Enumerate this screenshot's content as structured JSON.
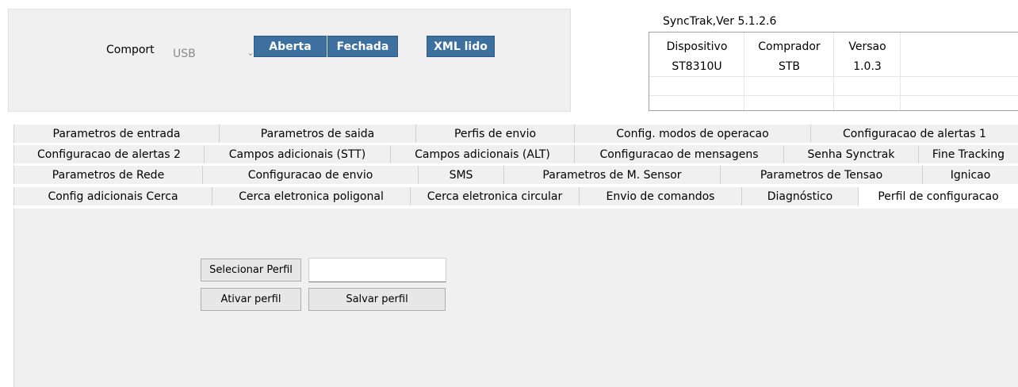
{
  "comport": {
    "label": "Comport",
    "selected": "USB",
    "buttons": {
      "open": "Aberta",
      "close": "Fechada",
      "xml": "XML lido"
    }
  },
  "version": {
    "title": "SyncTrak,Ver 5.1.2.6",
    "columns": [
      "Dispositivo",
      "Comprador",
      "Versao"
    ],
    "row": [
      "ST8310U",
      "STB",
      "1.0.3"
    ]
  },
  "tabs": {
    "row1": [
      "Parametros de entrada",
      "Parametros de saida",
      "Perfis de envio",
      "Config. modos de operacao",
      "Configuracao de alertas 1"
    ],
    "row2": [
      "Configuracao de alertas 2",
      "Campos adicionais (STT)",
      "Campos adicionais (ALT)",
      "Configuracao de mensagens",
      "Senha Synctrak",
      "Fine Tracking"
    ],
    "row3": [
      "Parametros de Rede",
      "Configuracao de envio",
      "SMS",
      "Parametros de M. Sensor",
      "Parametros de Tensao",
      "Ignicao"
    ],
    "row4": [
      "Config adicionais Cerca",
      "Cerca eletronica poligonal",
      "Cerca eletronica circular",
      "Envio de comandos",
      "Diagnóstico",
      "Perfil de configuracao"
    ],
    "active": "Perfil de configuracao"
  },
  "profile": {
    "select_button": "Selecionar Perfil",
    "path_value": "",
    "activate_button": "Ativar perfil",
    "save_button": "Salvar perfil"
  }
}
